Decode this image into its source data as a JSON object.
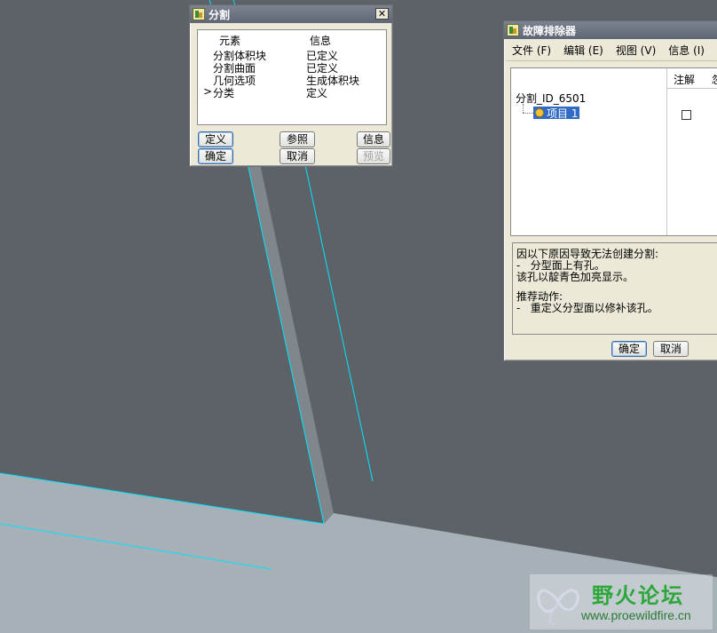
{
  "split_dialog": {
    "title": "分割",
    "close_glyph": "✕",
    "columns": [
      "元素",
      "信息"
    ],
    "rows": [
      {
        "marker": "",
        "element": "分割体积块",
        "info": "已定义"
      },
      {
        "marker": "",
        "element": "分割曲面",
        "info": "已定义"
      },
      {
        "marker": "",
        "element": "几何选项",
        "info": "生成体积块"
      },
      {
        "marker": ">",
        "element": "分类",
        "info": "定义"
      }
    ],
    "buttons": {
      "define": "定义",
      "reference": "参照",
      "info": "信息",
      "ok": "确定",
      "cancel": "取消",
      "preview": "预览"
    }
  },
  "troubleshooter": {
    "title": "故障排除器",
    "menu": [
      "文件 (F)",
      "编辑 (E)",
      "视图 (V)",
      "信息 (I)"
    ],
    "columns": [
      "注解",
      "忽"
    ],
    "tree_root": "分割_ID_6501",
    "tree_child": "项目 1",
    "message_lines": [
      "因以下原因导致无法创建分割:",
      "-   分型面上有孔。",
      "该孔以靛青色加亮显示。",
      "",
      "推荐动作:",
      "-   重定义分型面以修补该孔。"
    ],
    "buttons": {
      "ok": "确定",
      "cancel": "取消"
    }
  },
  "watermark": {
    "text": "野火论坛",
    "url": "www.proewildfire.cn"
  },
  "colors": {
    "background": "#5d6268",
    "model_surface": "#a5b0b7",
    "highlight_edge": "#00e5ff",
    "selection": "#316ac5"
  }
}
